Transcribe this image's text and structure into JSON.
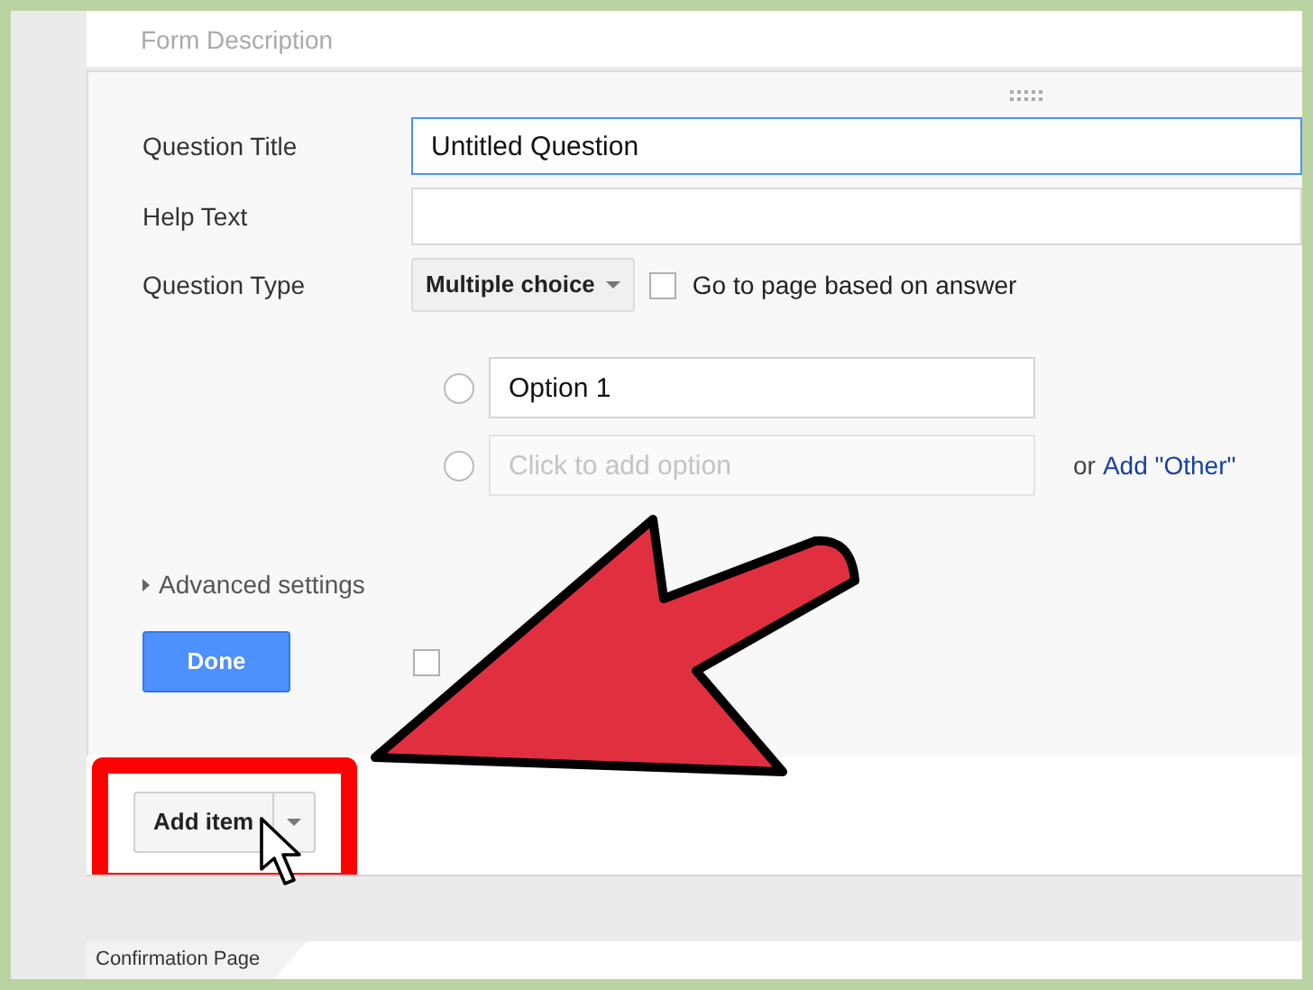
{
  "form_description": {
    "placeholder": "Form Description"
  },
  "fields": [
    {
      "label": "Question Title",
      "value": "Untitled Question",
      "focused": true
    },
    {
      "label": "Help Text",
      "focused": false
    }
  ],
  "question_type": {
    "label": "Question Type",
    "value": "Multiple choice",
    "go_to_page": {
      "label": "Go to page based on answer",
      "checked": false
    }
  },
  "options": [
    {
      "kind": "option",
      "value": "Option 1",
      "selected": false
    },
    {
      "kind": "add",
      "placeholder": "Click to add option",
      "selected": false
    }
  ],
  "add_other": {
    "prefix": "or",
    "link": "Add \"Other\""
  },
  "advanced_settings": "Advanced settings",
  "done": "Done",
  "extra_checkbox": {
    "checked": false
  },
  "add_item": "Add item",
  "confirmation_tab": "Confirmation Page"
}
